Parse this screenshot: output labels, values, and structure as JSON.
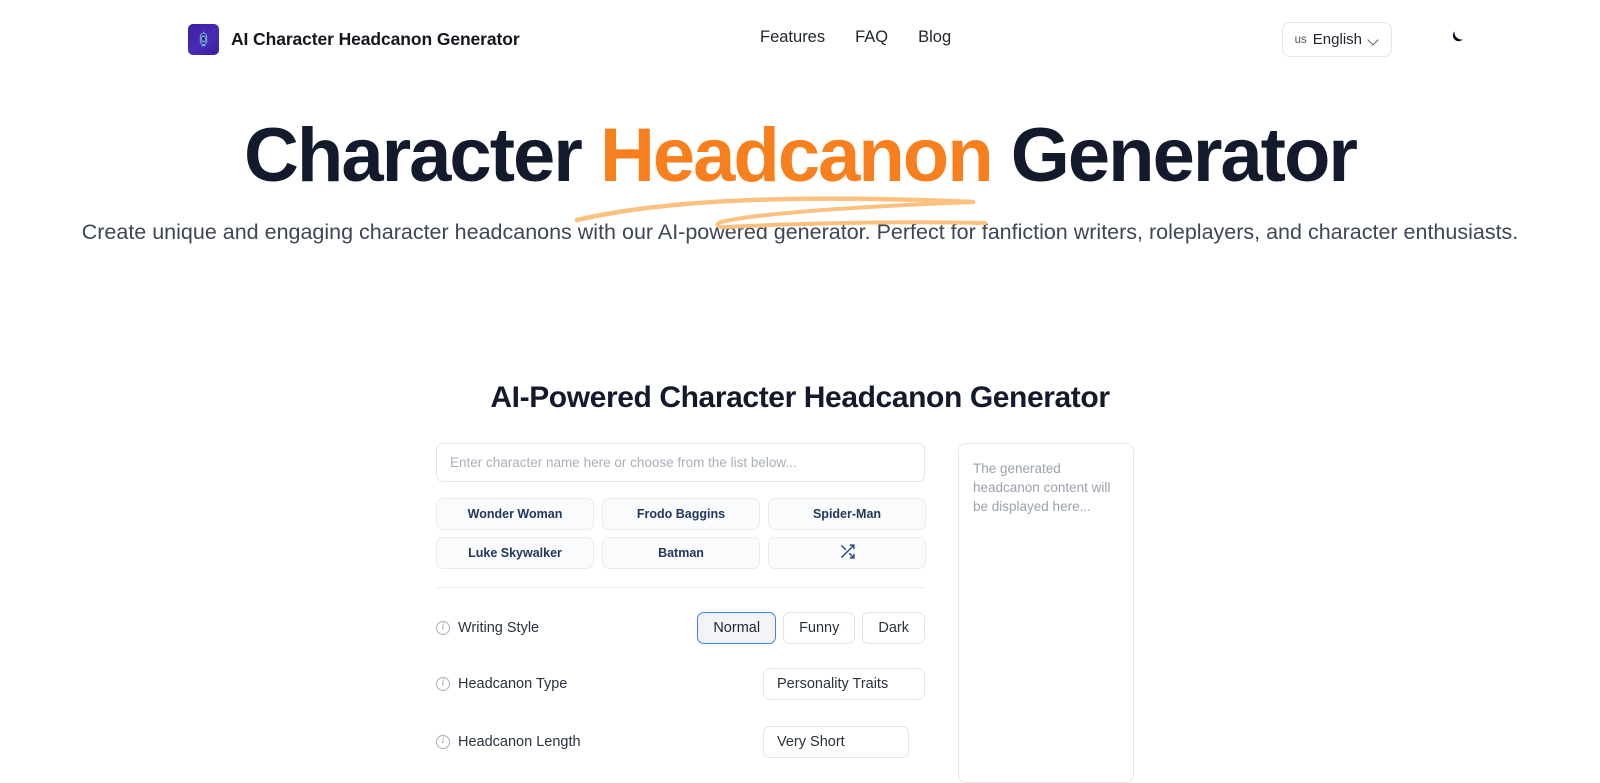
{
  "header": {
    "brand_title": "AI Character Headcanon Generator",
    "brand_logo_icon": "lantern-logo-icon",
    "nav": [
      {
        "label": "Features"
      },
      {
        "label": "FAQ"
      },
      {
        "label": "Blog"
      }
    ],
    "language": {
      "country_code": "us",
      "label": "English",
      "chevron_icon": "chevron-down-icon"
    },
    "theme_toggle_icon": "moon-icon"
  },
  "hero": {
    "title_part1": "Character ",
    "title_highlight": "Headcanon",
    "title_part2": " Generator",
    "subtitle": "Create unique and engaging character headcanons with our AI-powered generator. Perfect for fanfiction writers, roleplayers, and character enthusiasts."
  },
  "generator": {
    "section_title": "AI-Powered Character Headcanon Generator",
    "name_input": {
      "value": "",
      "placeholder": "Enter character name here or choose from the list below..."
    },
    "character_chips": [
      {
        "label": "Wonder Woman"
      },
      {
        "label": "Frodo Baggins"
      },
      {
        "label": "Spider-Man"
      },
      {
        "label": "Luke Skywalker"
      },
      {
        "label": "Batman"
      }
    ],
    "shuffle_button": {
      "icon": "shuffle-icon",
      "label": ""
    },
    "settings": [
      {
        "label": "Writing Style",
        "info_icon": "info-icon",
        "control": "segmented",
        "options": [
          "Normal",
          "Funny",
          "Dark"
        ],
        "selected": "Normal"
      },
      {
        "label": "Headcanon Type",
        "info_icon": "info-icon",
        "control": "select",
        "selected": "Personality Traits"
      },
      {
        "label": "Headcanon Length",
        "info_icon": "info-icon",
        "control": "select",
        "selected": "Very Short"
      }
    ],
    "output_panel": {
      "placeholder": "The generated headcanon content will be displayed here..."
    }
  },
  "colors": {
    "accent_orange": "#f77f1e",
    "swoosh_orange": "#fbc180",
    "heading_navy": "#131a2b",
    "chip_text": "#22365f",
    "selected_border_blue": "#3b82f6",
    "logo_purple": "#3b1f9e"
  }
}
